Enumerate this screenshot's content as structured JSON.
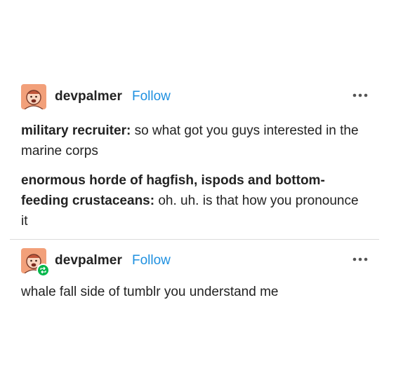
{
  "posts": [
    {
      "username": "devpalmer",
      "follow_label": "Follow",
      "lines": [
        {
          "speaker": "military recruiter:",
          "text": "so what got you guys interested in the marine corps"
        },
        {
          "speaker": "enormous horde of hagfish, ispods and bottom-feeding crustaceans:",
          "text": "oh. uh. is that how you pronounce it"
        }
      ]
    },
    {
      "username": "devpalmer",
      "follow_label": "Follow",
      "text": "whale fall side of tumblr you understand me"
    }
  ],
  "icons": {
    "avatar": "avatar-icon",
    "reblog": "reblog-icon",
    "more": "more-options-icon"
  },
  "colors": {
    "follow": "#1e90e0",
    "reblog_badge": "#00b64a",
    "avatar_bg": "#f2a07a"
  }
}
